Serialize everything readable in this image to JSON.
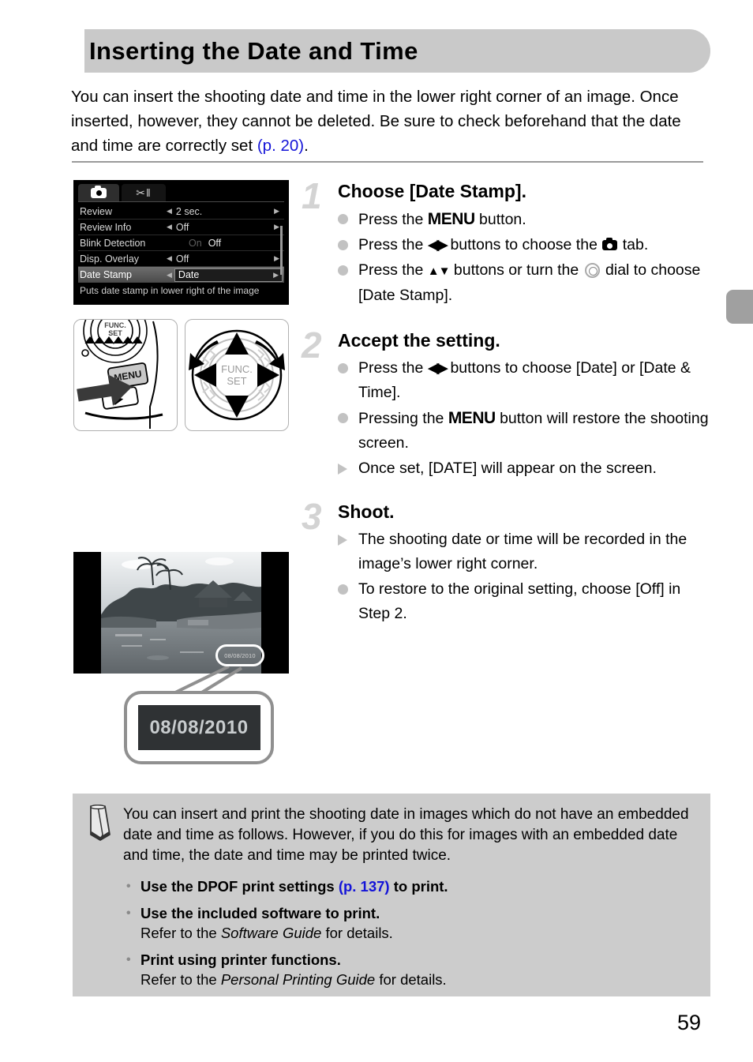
{
  "header": {
    "title": "Inserting the Date and Time"
  },
  "intro": {
    "text_before": "You can insert the shooting date and time in the lower right corner of an image. Once inserted, however, they cannot be deleted. Be sure to check beforehand that the date and time are correctly set ",
    "page_ref": "(p. 20)",
    "text_after": "."
  },
  "lcd_menu": {
    "tabs": [
      {
        "name": "shooting-tab",
        "icon": "camera-icon",
        "active": true
      },
      {
        "name": "settings-tab",
        "icon": "wrench-tools-icon",
        "active": false
      }
    ],
    "rows": [
      {
        "label": "Review",
        "value": "2 sec.",
        "type": "arrows"
      },
      {
        "label": "Review Info",
        "value": "Off",
        "type": "arrows"
      },
      {
        "label": "Blink Detection",
        "value_on": "On",
        "value_off": "Off",
        "type": "dual"
      },
      {
        "label": "Disp. Overlay",
        "value": "Off",
        "type": "arrows"
      },
      {
        "label": "Date Stamp",
        "value": "Date",
        "type": "highlight"
      }
    ],
    "caption": "Puts date stamp in lower right of the image",
    "arrow_left": "◀",
    "arrow_right": "▶"
  },
  "illustrations": {
    "menu_button": {
      "label": "MENU",
      "name": "camera-menu-button-illustration"
    },
    "control_dial": {
      "label": "FUNC. SET",
      "label_line1": "FUNC.",
      "label_line2": "SET",
      "name": "control-dial-illustration"
    }
  },
  "photo": {
    "date_stamp_small": "08/08/2010",
    "date_stamp_large": "08/08/2010"
  },
  "steps": [
    {
      "number": "1",
      "title": "Choose [Date Stamp].",
      "bullets": [
        {
          "marker": "dot",
          "parts": [
            {
              "t": "text",
              "v": "Press the "
            },
            {
              "t": "menu",
              "v": "MENU"
            },
            {
              "t": "text",
              "v": " button."
            }
          ]
        },
        {
          "marker": "dot",
          "parts": [
            {
              "t": "text",
              "v": "Press the "
            },
            {
              "t": "lr",
              "v": "◀▶"
            },
            {
              "t": "text",
              "v": " buttons to choose the "
            },
            {
              "t": "cam",
              "v": ""
            },
            {
              "t": "text",
              "v": " tab."
            }
          ]
        },
        {
          "marker": "dot",
          "parts": [
            {
              "t": "text",
              "v": "Press the "
            },
            {
              "t": "ud",
              "v": "▲▼"
            },
            {
              "t": "text",
              "v": " buttons or turn the "
            },
            {
              "t": "dial",
              "v": ""
            },
            {
              "t": "text",
              "v": " dial to choose [Date Stamp]."
            }
          ]
        }
      ]
    },
    {
      "number": "2",
      "title": "Accept the setting.",
      "bullets": [
        {
          "marker": "dot",
          "parts": [
            {
              "t": "text",
              "v": "Press the "
            },
            {
              "t": "lr",
              "v": "◀▶"
            },
            {
              "t": "text",
              "v": " buttons to choose [Date] or [Date & Time]."
            }
          ]
        },
        {
          "marker": "dot",
          "parts": [
            {
              "t": "text",
              "v": "Pressing the "
            },
            {
              "t": "menu",
              "v": "MENU"
            },
            {
              "t": "text",
              "v": " button will restore the shooting screen."
            }
          ]
        },
        {
          "marker": "tri",
          "parts": [
            {
              "t": "text",
              "v": "Once set, [DATE] will appear on the screen."
            }
          ]
        }
      ]
    },
    {
      "number": "3",
      "title": "Shoot.",
      "bullets": [
        {
          "marker": "tri",
          "parts": [
            {
              "t": "text",
              "v": "The shooting date or time will be recorded in the image’s lower right corner."
            }
          ]
        },
        {
          "marker": "dot",
          "parts": [
            {
              "t": "text",
              "v": "To restore to the original setting, choose [Off] in Step 2."
            }
          ]
        }
      ]
    }
  ],
  "note": {
    "icon": "pencil-icon",
    "paragraph": "You can insert and print the shooting date in images which do not have an embedded date and time as follows. However, if you do this for images with an embedded date and time, the date and time may be printed twice.",
    "bullet_char": "•",
    "items": [
      {
        "bold_before": "Use the DPOF print settings ",
        "page_ref": "(p. 137)",
        "bold_after": " to print.",
        "sub_before": "",
        "sub_italic": "",
        "sub_after": ""
      },
      {
        "bold_before": "Use the included software to print.",
        "page_ref": "",
        "bold_after": "",
        "sub_before": "Refer to the ",
        "sub_italic": "Software Guide",
        "sub_after": " for details."
      },
      {
        "bold_before": "Print using printer functions.",
        "page_ref": "",
        "bold_after": "",
        "sub_before": "Refer to the ",
        "sub_italic": "Personal Printing Guide",
        "sub_after": " for details."
      }
    ]
  },
  "footer": {
    "page_number": "59"
  },
  "colors": {
    "banner_gray": "#c9c9c9",
    "note_gray": "#cccccc",
    "link_blue": "#1414d8",
    "marker_gray": "#c2c2c2",
    "step_num_gray": "#d3d3d3",
    "tab_gray": "#a0a0a0"
  }
}
